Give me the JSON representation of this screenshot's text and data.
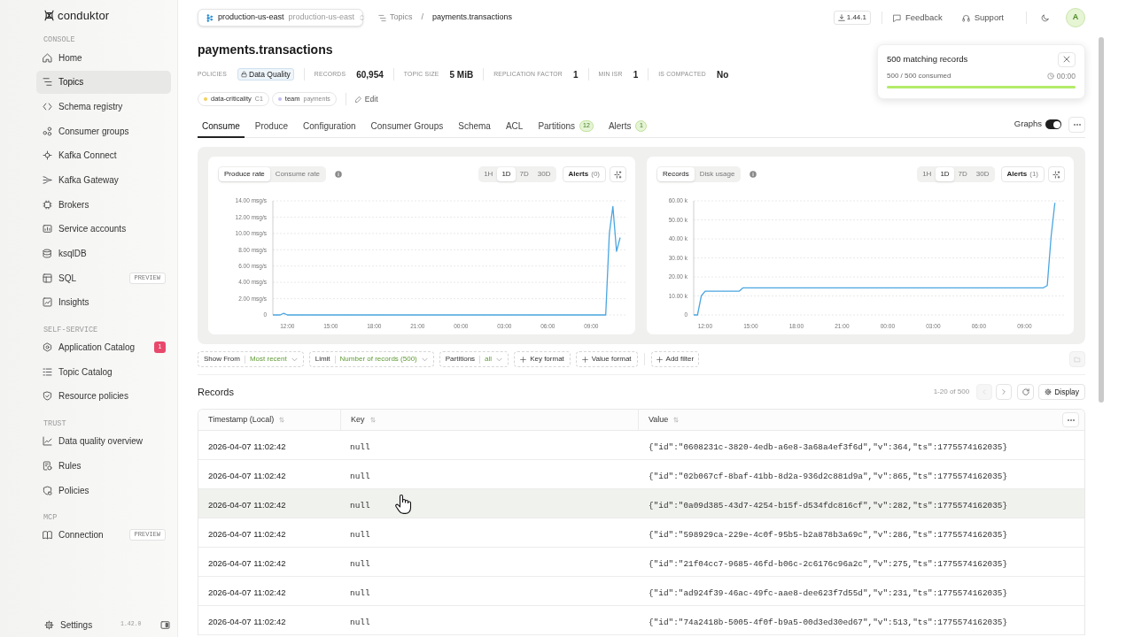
{
  "sidebar": {
    "logo": "conduktor",
    "sections": [
      {
        "label": "CONSOLE",
        "items": [
          {
            "label": "Home",
            "selected": false
          },
          {
            "label": "Topics",
            "selected": true
          },
          {
            "label": "Schema registry",
            "selected": false
          },
          {
            "label": "Consumer groups",
            "selected": false
          },
          {
            "label": "Kafka Connect",
            "selected": false
          },
          {
            "label": "Kafka Gateway",
            "selected": false
          },
          {
            "label": "Brokers",
            "selected": false
          },
          {
            "label": "Service accounts",
            "selected": false
          },
          {
            "label": "ksqlDB",
            "selected": false
          },
          {
            "label": "SQL",
            "tag": "PREVIEW",
            "selected": false
          },
          {
            "label": "Insights",
            "selected": false
          }
        ]
      },
      {
        "label": "SELF-SERVICE",
        "items": [
          {
            "label": "Application Catalog",
            "count": "1",
            "selected": false
          },
          {
            "label": "Topic Catalog",
            "selected": false
          },
          {
            "label": "Resource policies",
            "selected": false
          }
        ]
      },
      {
        "label": "TRUST",
        "items": [
          {
            "label": "Data quality overview",
            "selected": false
          },
          {
            "label": "Rules",
            "selected": false
          },
          {
            "label": "Policies",
            "selected": false
          }
        ]
      },
      {
        "label": "MCP",
        "items": [
          {
            "label": "Connection",
            "tag": "PREVIEW",
            "selected": false
          }
        ]
      }
    ],
    "footer": {
      "label": "Settings",
      "version": "1.42.0"
    }
  },
  "header": {
    "environment": {
      "name": "production-us-east",
      "cluster": "production-us-east"
    },
    "breadcrumb": {
      "parent": "Topics",
      "separator": "/",
      "current": "payments.transactions"
    },
    "version": "1.44.1",
    "links": [
      "Feedback",
      "Support"
    ],
    "avatar": "A"
  },
  "topic": {
    "title": "payments.transactions",
    "stats": [
      {
        "label": "POLICIES",
        "kind": "badge",
        "value": "Data Quality"
      },
      {
        "label": "RECORDS",
        "kind": "value",
        "value": "60,954"
      },
      {
        "label": "TOPIC SIZE",
        "kind": "value",
        "value": "5 MiB"
      },
      {
        "label": "REPLICATION FACTOR",
        "kind": "value",
        "value": "1"
      },
      {
        "label": "MIN ISR",
        "kind": "value",
        "value": "1"
      },
      {
        "label": "IS COMPACTED",
        "kind": "value",
        "value": "No"
      }
    ],
    "tags": [
      {
        "key": "data-criticality",
        "value": "C1",
        "color": "#f2cf5b"
      },
      {
        "key": "team",
        "value": "payments",
        "color": "#c4bbf0"
      }
    ],
    "edit": "Edit"
  },
  "tabs": [
    {
      "label": "Consume",
      "selected": true
    },
    {
      "label": "Produce",
      "selected": false
    },
    {
      "label": "Configuration",
      "selected": false
    },
    {
      "label": "Consumer Groups",
      "selected": false
    },
    {
      "label": "Schema",
      "selected": false
    },
    {
      "label": "ACL",
      "selected": false
    },
    {
      "label": "Partitions",
      "count": "12",
      "selected": false
    },
    {
      "label": "Alerts",
      "count": "1",
      "selected": false
    }
  ],
  "toolbar": {
    "graphs": {
      "label": "Graphs",
      "on": true
    }
  },
  "toast": {
    "title": "500 matching records",
    "progress_text": "500 / 500 consumed",
    "elapsed": "00:00",
    "level": 1
  },
  "charts": [
    {
      "metrics": [
        {
          "label": "Produce rate",
          "selected": true
        },
        {
          "label": "Consume rate",
          "selected": false
        }
      ],
      "ranges": [
        {
          "label": "1H",
          "selected": false
        },
        {
          "label": "1D",
          "selected": true
        },
        {
          "label": "7D",
          "selected": false
        },
        {
          "label": "30D",
          "selected": false
        }
      ],
      "alerts": {
        "label": "Alerts",
        "count": "(0)"
      },
      "chart_data": {
        "type": "line",
        "grid": true,
        "categories": [
          null,
          null,
          null,
          null,
          "12:00",
          null,
          null,
          null,
          null,
          null,
          null,
          null,
          null,
          null,
          null,
          null,
          "15:00",
          null,
          null,
          null,
          null,
          null,
          null,
          null,
          null,
          null,
          null,
          null,
          "18:00",
          null,
          null,
          null,
          null,
          null,
          null,
          null,
          null,
          null,
          null,
          null,
          "21:00",
          null,
          null,
          null,
          null,
          null,
          null,
          null,
          null,
          null,
          null,
          null,
          "00:00",
          null,
          null,
          null,
          null,
          null,
          null,
          null,
          null,
          null,
          null,
          null,
          "03:00",
          null,
          null,
          null,
          null,
          null,
          null,
          null,
          null,
          null,
          null,
          null,
          "06:00",
          null,
          null,
          null,
          null,
          null,
          null,
          null,
          null,
          null,
          null,
          null,
          "09:00",
          null,
          null,
          null,
          null,
          null,
          null,
          null,
          null
        ],
        "series": [
          {
            "color": "#4aa6e0",
            "values": [
              0,
              0,
              0,
              0.2,
              0,
              0,
              0,
              0,
              0,
              0,
              0,
              0,
              0,
              0,
              0,
              0,
              0,
              0,
              0,
              0,
              0,
              0,
              0,
              0,
              0,
              0,
              0,
              0,
              0,
              0,
              0,
              0,
              0,
              0,
              0,
              0,
              0,
              0,
              0,
              0,
              0,
              0,
              0,
              0,
              0,
              0,
              0,
              0,
              0,
              0,
              0,
              0,
              0,
              0,
              0,
              0,
              0,
              0,
              0,
              0,
              0,
              0,
              0,
              0,
              0,
              0,
              0,
              0,
              0,
              0,
              0,
              0,
              0,
              0,
              0,
              0,
              0,
              0,
              0,
              0,
              0,
              0,
              0,
              0,
              0,
              0,
              0,
              0,
              0,
              0,
              0,
              0,
              0,
              10,
              13.3,
              7.8,
              9.5
            ]
          }
        ],
        "ylim": [
          0,
          14
        ],
        "yticks": [
          {
            "value": 0,
            "label": "0"
          },
          {
            "value": 2,
            "label": "2.00 msg/s"
          },
          {
            "value": 4,
            "label": "4.00 msg/s"
          },
          {
            "value": 6,
            "label": "6.00 msg/s"
          },
          {
            "value": 8,
            "label": "8.00 msg/s"
          },
          {
            "value": 10,
            "label": "10.00 msg/s"
          },
          {
            "value": 12,
            "label": "12.00 msg/s"
          },
          {
            "value": 14,
            "label": "14.00 msg/s"
          }
        ]
      }
    },
    {
      "metrics": [
        {
          "label": "Records",
          "selected": true
        },
        {
          "label": "Disk usage",
          "selected": false
        }
      ],
      "ranges": [
        {
          "label": "1H",
          "selected": false
        },
        {
          "label": "1D",
          "selected": true
        },
        {
          "label": "7D",
          "selected": false
        },
        {
          "label": "30D",
          "selected": false
        }
      ],
      "alerts": {
        "label": "Alerts",
        "count": "(1)"
      },
      "chart_data": {
        "type": "line",
        "grid": true,
        "categories": [
          null,
          null,
          null,
          "12:00",
          null,
          null,
          null,
          null,
          null,
          null,
          null,
          null,
          null,
          null,
          null,
          "15:00",
          null,
          null,
          null,
          null,
          null,
          null,
          null,
          null,
          null,
          null,
          null,
          "18:00",
          null,
          null,
          null,
          null,
          null,
          null,
          null,
          null,
          null,
          null,
          null,
          "21:00",
          null,
          null,
          null,
          null,
          null,
          null,
          null,
          null,
          null,
          null,
          null,
          "00:00",
          null,
          null,
          null,
          null,
          null,
          null,
          null,
          null,
          null,
          null,
          null,
          "03:00",
          null,
          null,
          null,
          null,
          null,
          null,
          null,
          null,
          null,
          null,
          null,
          "06:00",
          null,
          null,
          null,
          null,
          null,
          null,
          null,
          null,
          null,
          null,
          null,
          "09:00",
          null,
          null,
          null,
          null,
          null,
          null,
          null,
          null,
          null
        ],
        "series": [
          {
            "color": "#4aa6e0",
            "values": [
              0,
              0,
              10000,
              12500,
              12500,
              12500,
              12500,
              12500,
              12500,
              12500,
              12500,
              12500,
              12500,
              14300,
              14300,
              14300,
              14300,
              14300,
              14300,
              14300,
              14300,
              14300,
              14300,
              14300,
              14300,
              14300,
              14300,
              14300,
              14300,
              14300,
              14300,
              14300,
              14300,
              14300,
              14300,
              14300,
              14300,
              14300,
              14300,
              14300,
              14300,
              14300,
              14300,
              14300,
              14300,
              14300,
              14300,
              14300,
              14300,
              14300,
              14300,
              14300,
              14300,
              14300,
              14300,
              14300,
              14300,
              14300,
              14300,
              14300,
              14300,
              14300,
              14300,
              14300,
              14300,
              14300,
              14300,
              14300,
              14300,
              14300,
              14300,
              14300,
              14300,
              14300,
              14300,
              14300,
              14300,
              14300,
              14300,
              14300,
              14300,
              14300,
              14300,
              14300,
              14300,
              14300,
              14300,
              14300,
              14300,
              14300,
              14300,
              14300,
              14300,
              15500,
              41000,
              59000,
              null
            ]
          }
        ],
        "ylim": [
          0,
          60000
        ],
        "yticks": [
          {
            "value": 0,
            "label": "0"
          },
          {
            "value": 10000,
            "label": "10.00 k"
          },
          {
            "value": 20000,
            "label": "20.00 k"
          },
          {
            "value": 30000,
            "label": "30.00 k"
          },
          {
            "value": 40000,
            "label": "40.00 k"
          },
          {
            "value": 50000,
            "label": "50.00 k"
          },
          {
            "value": 60000,
            "label": "60.00 k"
          }
        ]
      }
    }
  ],
  "filters": [
    {
      "kind": "select",
      "label": "Show From",
      "value": "Most recent"
    },
    {
      "kind": "select",
      "label": "Limit",
      "value": "Number of records (500)"
    },
    {
      "kind": "select",
      "label": "Partitions",
      "value": "all"
    },
    {
      "kind": "add",
      "label": "Key format"
    },
    {
      "kind": "add",
      "label": "Value format"
    }
  ],
  "add_filter": {
    "label": "Add filter"
  },
  "records": {
    "title": "Records",
    "pagination": {
      "range": "1-20 of 500",
      "previous_disabled": true,
      "next_disabled": false
    },
    "display": "Display",
    "columns": [
      "Timestamp (Local)",
      "Key",
      "Value"
    ],
    "rows": [
      {
        "timestamp": "2026-04-07 11:02:42",
        "key": "null",
        "value": "{\"id\":\"0608231c-3820-4edb-a6e8-3a68a4ef3f6d\",\"v\":364,\"ts\":1775574162035}",
        "highlighted": false
      },
      {
        "timestamp": "2026-04-07 11:02:42",
        "key": "null",
        "value": "{\"id\":\"02b067cf-8baf-41bb-8d2a-936d2c881d9a\",\"v\":865,\"ts\":1775574162035}",
        "highlighted": false
      },
      {
        "timestamp": "2026-04-07 11:02:42",
        "key": "null",
        "value": "{\"id\":\"0a09d385-43d7-4254-b15f-d534fdc816cf\",\"v\":282,\"ts\":1775574162035}",
        "highlighted": true
      },
      {
        "timestamp": "2026-04-07 11:02:42",
        "key": "null",
        "value": "{\"id\":\"598929ca-229e-4c0f-95b5-b2a878b3a69c\",\"v\":286,\"ts\":1775574162035}",
        "highlighted": false
      },
      {
        "timestamp": "2026-04-07 11:02:42",
        "key": "null",
        "value": "{\"id\":\"21f04cc7-9685-46fd-b06c-2c6176c96a2c\",\"v\":275,\"ts\":1775574162035}",
        "highlighted": false
      },
      {
        "timestamp": "2026-04-07 11:02:42",
        "key": "null",
        "value": "{\"id\":\"ad924f39-46ac-49fc-aae8-dee623f7d55d\",\"v\":231,\"ts\":1775574162035}",
        "highlighted": false
      },
      {
        "timestamp": "2026-04-07 11:02:42",
        "key": "null",
        "value": "{\"id\":\"74a2418b-5005-4f0f-b9a5-00d3ed30ed67\",\"v\":513,\"ts\":1775574162035}",
        "highlighted": false
      }
    ]
  }
}
